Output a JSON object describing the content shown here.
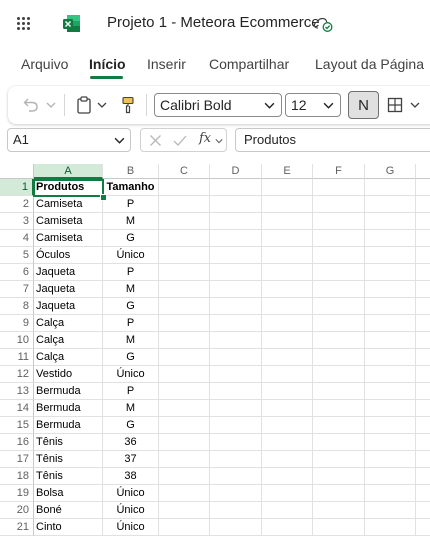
{
  "app": {
    "document_title": "Projeto 1 - Meteora Ecommerce"
  },
  "ribbon_tabs": [
    {
      "label": "Arquivo"
    },
    {
      "label": "Início"
    },
    {
      "label": "Inserir"
    },
    {
      "label": "Compartilhar"
    },
    {
      "label": "Layout da Página"
    }
  ],
  "active_tab": "Início",
  "toolbar": {
    "font_name": "Calibri Bold",
    "font_size": "12",
    "n_button": "N"
  },
  "formula_bar": {
    "name_box": "A1",
    "fx_label": "fx",
    "formula_value": "Produtos"
  },
  "sheet": {
    "columns": [
      "A",
      "B",
      "C",
      "D",
      "E",
      "F",
      "G"
    ],
    "selected_cell": "A1",
    "rows": [
      {
        "n": "1",
        "a": "Produtos",
        "b": "Tamanho"
      },
      {
        "n": "2",
        "a": "Camiseta",
        "b": "P"
      },
      {
        "n": "3",
        "a": "Camiseta",
        "b": "M"
      },
      {
        "n": "4",
        "a": "Camiseta",
        "b": "G"
      },
      {
        "n": "5",
        "a": "Óculos",
        "b": "Único"
      },
      {
        "n": "6",
        "a": "Jaqueta",
        "b": "P"
      },
      {
        "n": "7",
        "a": "Jaqueta",
        "b": "M"
      },
      {
        "n": "8",
        "a": "Jaqueta",
        "b": "G"
      },
      {
        "n": "9",
        "a": "Calça",
        "b": "P"
      },
      {
        "n": "10",
        "a": "Calça",
        "b": "M"
      },
      {
        "n": "11",
        "a": "Calça",
        "b": "G"
      },
      {
        "n": "12",
        "a": "Vestido",
        "b": "Único"
      },
      {
        "n": "13",
        "a": "Bermuda",
        "b": "P"
      },
      {
        "n": "14",
        "a": "Bermuda",
        "b": "M"
      },
      {
        "n": "15",
        "a": "Bermuda",
        "b": "G"
      },
      {
        "n": "16",
        "a": "Tênis",
        "b": "36"
      },
      {
        "n": "17",
        "a": "Tênis",
        "b": "37"
      },
      {
        "n": "18",
        "a": "Tênis",
        "b": "38"
      },
      {
        "n": "19",
        "a": "Bolsa",
        "b": "Único"
      },
      {
        "n": "20",
        "a": "Boné",
        "b": "Único"
      },
      {
        "n": "21",
        "a": "Cinto",
        "b": "Único"
      }
    ]
  },
  "colors": {
    "accent": "#107c41",
    "header_selected": "#d3ead9"
  },
  "icons": [
    "app-launcher-icon",
    "excel-logo-icon",
    "cloud-saved-icon",
    "undo-icon",
    "clipboard-icon",
    "format-painter-icon",
    "chevron-down-icon",
    "borders-icon",
    "cancel-icon",
    "confirm-icon"
  ]
}
